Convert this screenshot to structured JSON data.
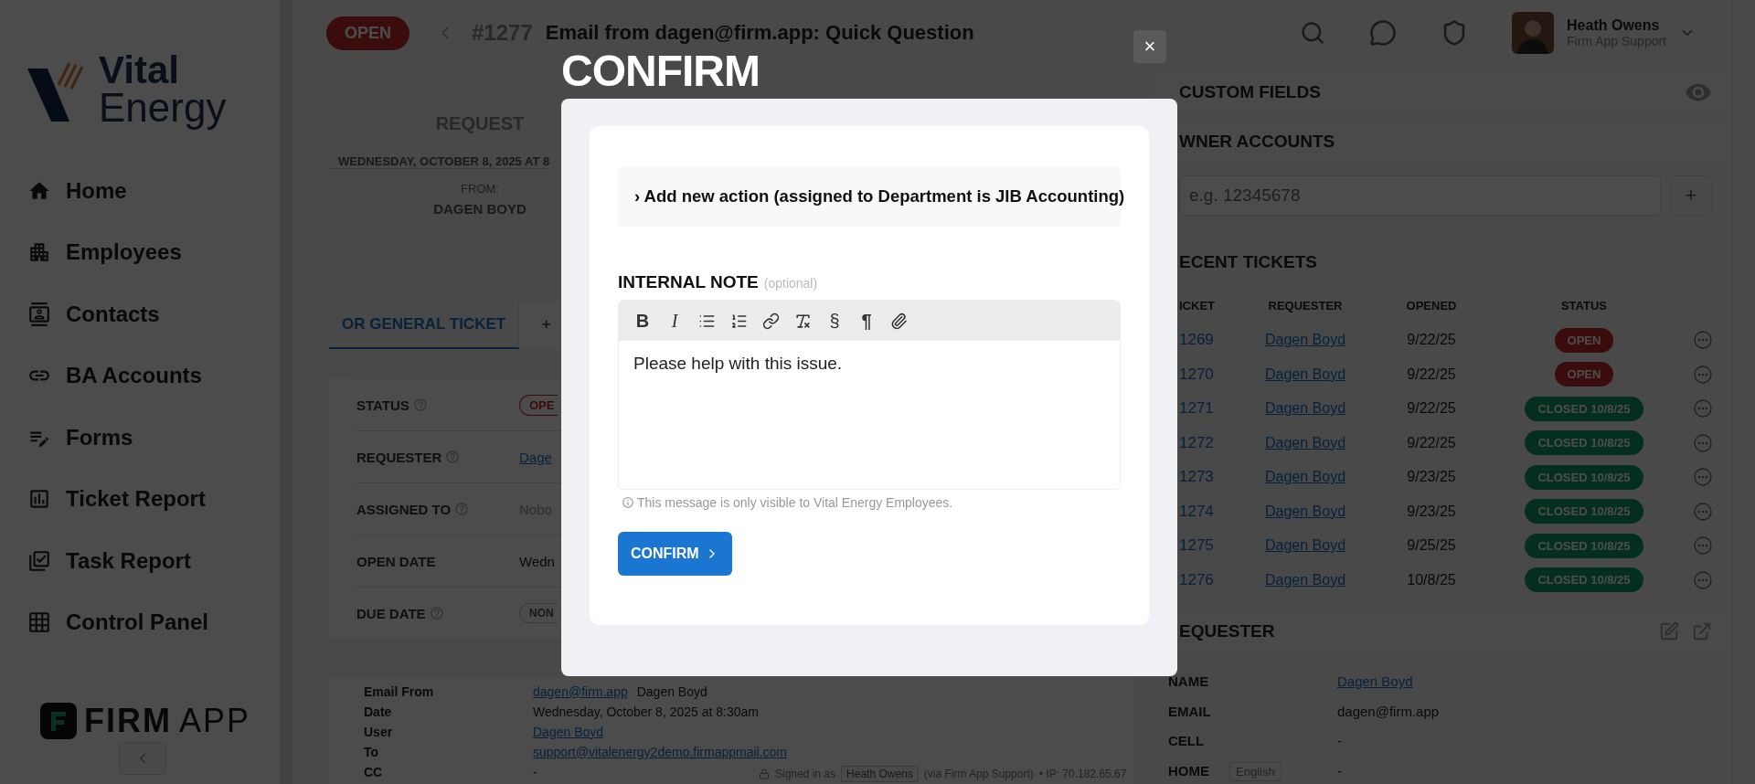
{
  "sidebar": {
    "logo": {
      "line1": "Vital",
      "line2": "Energy"
    },
    "items": [
      {
        "label": "Home",
        "kind": "home"
      },
      {
        "label": "Employees",
        "kind": "building"
      },
      {
        "label": "Contacts",
        "kind": "contacts"
      },
      {
        "label": "BA Accounts",
        "kind": "link"
      },
      {
        "label": "Forms",
        "kind": "form"
      },
      {
        "label": "Ticket Report",
        "kind": "report"
      },
      {
        "label": "Task Report",
        "kind": "tasks"
      },
      {
        "label": "Control Panel",
        "kind": "grid"
      }
    ],
    "footer_logo": {
      "bold": "FIRM",
      "light": "APP"
    }
  },
  "header": {
    "status": "OPEN",
    "ticket_number": "#1277",
    "title": "Email from dagen@firm.app: Quick Question",
    "user": {
      "name": "Heath Owens",
      "role": "Firm App Support"
    }
  },
  "request": {
    "heading": "REQUEST",
    "date": "WEDNESDAY, OCTOBER 8, 2025 AT 8",
    "from_label": "FROM:",
    "from": "DAGEN BOYD"
  },
  "tabs": [
    {
      "label": "OR GENERAL TICKET",
      "selected": true
    },
    {
      "label": "+",
      "selected": false
    }
  ],
  "fields": [
    {
      "label": "STATUS",
      "help": true,
      "kind": "badge",
      "value": "OPE"
    },
    {
      "label": "REQUESTER",
      "help": true,
      "kind": "link",
      "value": "Dage"
    },
    {
      "label": "ASSIGNED TO",
      "help": true,
      "kind": "muted",
      "value": "Nobo"
    },
    {
      "label": "OPEN DATE",
      "help": false,
      "kind": "text",
      "value": "Wedn"
    },
    {
      "label": "DUE DATE",
      "help": true,
      "kind": "chip",
      "value": "NON"
    }
  ],
  "email_meta": [
    {
      "label": "Email From",
      "kind": "link",
      "value": "dagen@firm.app",
      "extra": "Dagen Boyd"
    },
    {
      "label": "Date",
      "kind": "text",
      "value": "Wednesday, October 8, 2025 at 8:30am"
    },
    {
      "label": "User",
      "kind": "link",
      "value": "Dagen Boyd"
    },
    {
      "label": "To",
      "kind": "link",
      "value": "support@vitalenergy2demo.firmappmail.com"
    },
    {
      "label": "CC",
      "kind": "text",
      "value": "-"
    }
  ],
  "footer": {
    "signed_in": "Signed in as",
    "user": "Heath Owens",
    "via": "(via Firm App Support)",
    "ip": "• IP: 70.182.65.67",
    "language": "English"
  },
  "right_panel": {
    "custom_fields": "CUSTOM FIELDS",
    "owner_accounts": "WNER ACCOUNTS",
    "account_input": {
      "placeholder": "e.g. 12345678"
    },
    "add_button": "+",
    "recent": {
      "heading": "ECENT TICKETS",
      "columns": [
        "ICKET",
        "REQUESTER",
        "OPENED",
        "STATUS"
      ],
      "rows": [
        {
          "ticket": "1269",
          "requester": "Dagen Boyd",
          "opened": "9/22/25",
          "status": "OPEN",
          "kind": "open"
        },
        {
          "ticket": "1270",
          "requester": "Dagen Boyd",
          "opened": "9/22/25",
          "status": "OPEN",
          "kind": "open"
        },
        {
          "ticket": "1271",
          "requester": "Dagen Boyd",
          "opened": "9/22/25",
          "status": "CLOSED 10/8/25",
          "kind": "closed"
        },
        {
          "ticket": "1272",
          "requester": "Dagen Boyd",
          "opened": "9/22/25",
          "status": "CLOSED 10/8/25",
          "kind": "closed"
        },
        {
          "ticket": "1273",
          "requester": "Dagen Boyd",
          "opened": "9/23/25",
          "status": "CLOSED 10/8/25",
          "kind": "closed"
        },
        {
          "ticket": "1274",
          "requester": "Dagen Boyd",
          "opened": "9/23/25",
          "status": "CLOSED 10/8/25",
          "kind": "closed"
        },
        {
          "ticket": "1275",
          "requester": "Dagen Boyd",
          "opened": "9/25/25",
          "status": "CLOSED 10/8/25",
          "kind": "closed"
        },
        {
          "ticket": "1276",
          "requester": "Dagen Boyd",
          "opened": "10/8/25",
          "status": "CLOSED 10/8/25",
          "kind": "closed"
        }
      ]
    },
    "requester": {
      "heading": "EQUESTER",
      "rows": [
        {
          "label": "NAME",
          "kind": "link",
          "value": "Dagen Boyd"
        },
        {
          "label": "EMAIL",
          "kind": "text",
          "value": "dagen@firm.app"
        },
        {
          "label": "CELL",
          "kind": "text",
          "value": "-"
        },
        {
          "label": "HOME",
          "kind": "text",
          "value": "-"
        }
      ]
    }
  },
  "dialog": {
    "title": "CONFIRM",
    "close": "×",
    "action": "› Add new action (assigned to Department is JIB Accounting)",
    "note_label": "INTERNAL NOTE",
    "note_hint": "(optional)",
    "toolbar": [
      {
        "kind": "bold",
        "glyph": "B"
      },
      {
        "kind": "italic",
        "glyph": "I"
      },
      {
        "kind": "bullets"
      },
      {
        "kind": "numbers"
      },
      {
        "kind": "link"
      },
      {
        "kind": "clear"
      },
      {
        "kind": "section",
        "glyph": "§"
      },
      {
        "kind": "pilcrow",
        "glyph": "¶"
      },
      {
        "kind": "attach"
      }
    ],
    "note_text": "Please help with this issue.",
    "info": "This message is only visible to Vital Energy Employees.",
    "confirm": "CONFIRM"
  }
}
